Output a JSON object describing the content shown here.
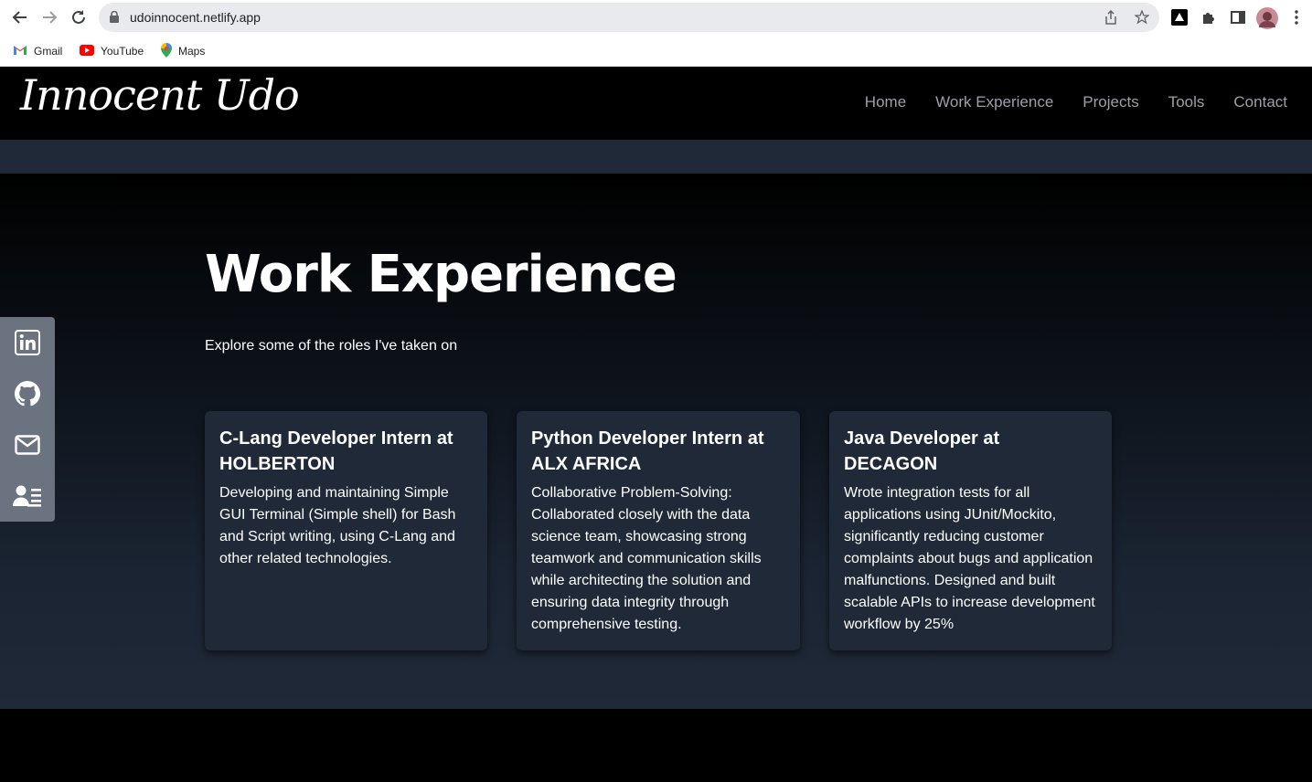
{
  "browser": {
    "url": "udoinnocent.netlify.app",
    "bookmarks": [
      {
        "label": "Gmail",
        "icon": "gmail-icon"
      },
      {
        "label": "YouTube",
        "icon": "youtube-icon"
      },
      {
        "label": "Maps",
        "icon": "maps-icon"
      }
    ]
  },
  "site": {
    "logo": "Innocent Udo",
    "nav": [
      "Home",
      "Work Experience",
      "Projects",
      "Tools",
      "Contact"
    ]
  },
  "work": {
    "title": "Work Experience",
    "subtitle": "Explore some of the roles I've taken on",
    "cards": [
      {
        "title": "C-Lang Developer Intern at HOLBERTON",
        "body": "Developing and maintaining Simple GUI Terminal (Simple shell) for Bash and Script writing, using C-Lang and other related technologies."
      },
      {
        "title": "Python Developer Intern at ALX AFRICA",
        "body": "Collaborative Problem-Solving: Collaborated closely with the data science team, showcasing strong teamwork and communication skills while architecting the solution and ensuring data integrity through comprehensive testing."
      },
      {
        "title": "Java Developer at DECAGON",
        "body": "Wrote integration tests for all applications using JUnit/Mockito, significantly reducing customer complaints about bugs and application malfunctions. Designed and built scalable APIs to increase development workflow by 25%"
      }
    ]
  },
  "social": [
    "linkedin-icon",
    "github-icon",
    "mail-icon",
    "contact-card-icon"
  ],
  "colors": {
    "nav_bg": "#000000",
    "card_bg": "#1f2937",
    "sidebar_bg": "#6b7280",
    "nav_text": "#9aa1ab"
  }
}
